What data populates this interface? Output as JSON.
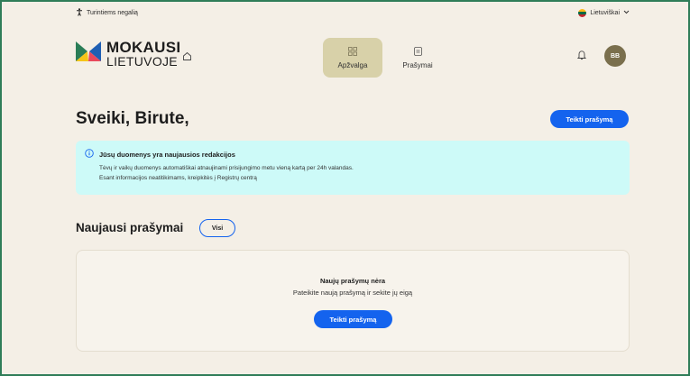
{
  "topbar": {
    "accessibility_label": "Turintiems negalią",
    "language_label": "Lietuviškai"
  },
  "logo": {
    "line1": "MOKAUSI",
    "line2": "LIETUVOJE"
  },
  "nav": {
    "items": [
      {
        "label": "Apžvalga",
        "active": true,
        "icon": "grid-icon"
      },
      {
        "label": "Prašymai",
        "active": false,
        "icon": "document-icon"
      }
    ]
  },
  "user": {
    "initials": "BB"
  },
  "greeting": "Sveiki, Birute,",
  "actions": {
    "submit_request": "Teikti prašymą"
  },
  "info": {
    "title": "Jūsų duomenys yra naujausios redakcijos",
    "line1": "Tėvų ir vaikų duomenys automatiškai atnaujinami prisijungimo metu vieną kartą per 24h valandas.",
    "line2": "Esant informacijos neatitikimams, kreipkitės į Registrų centrą"
  },
  "recent": {
    "title": "Naujausi prašymai",
    "all_label": "Visi",
    "empty_title": "Naujų prašymų nėra",
    "empty_subtitle": "Pateikite naują prašymą ir sekite jų eigą",
    "empty_button": "Teikti prašymą"
  },
  "colors": {
    "primary": "#1463ee",
    "background": "#f4efe6",
    "info_bg": "#cdfaf8",
    "nav_active_bg": "#d8d1a9",
    "avatar_bg": "#7a6f4d",
    "frame_border": "#2f7d58"
  }
}
